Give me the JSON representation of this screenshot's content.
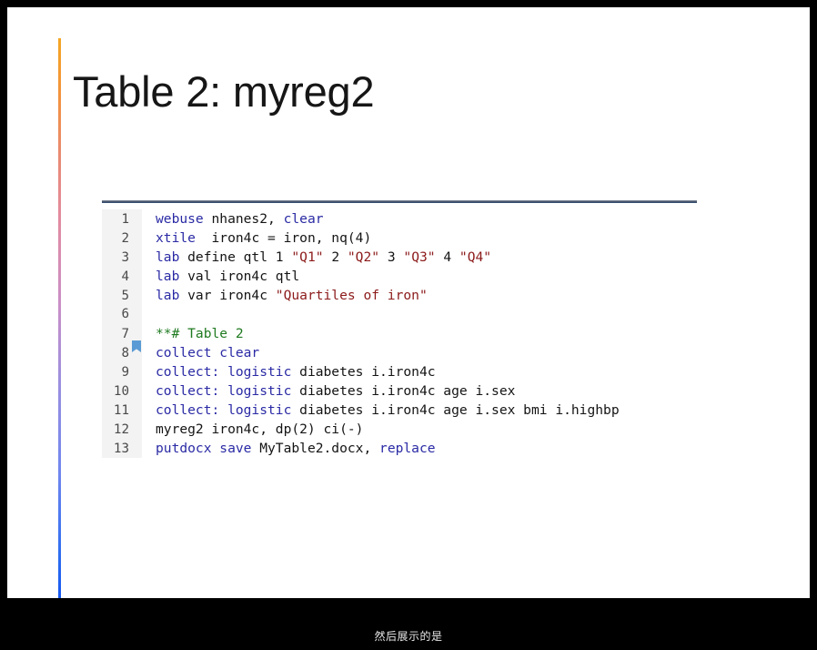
{
  "slide": {
    "title": "Table 2: myreg2",
    "accent_colors": {
      "top": "#f5a623",
      "middle": "#c98fc8",
      "bottom": "#1558f0"
    },
    "background": "#ffffff"
  },
  "caption": {
    "text": "然后展示的是"
  },
  "code_editor": {
    "syntax_colors": {
      "keyword": "#2a2aa5",
      "string": "#8c1a1a",
      "comment": "#1f7a20",
      "plain": "#141414",
      "line_number": "#4a4a4a",
      "gutter_background": "#f3f3f3",
      "bookmark_marker": "#5b9bd5"
    },
    "lines": [
      {
        "number": "1",
        "marker": "",
        "tokens": [
          {
            "text": "webuse",
            "type": "kw"
          },
          {
            "text": " nhanes2, ",
            "type": "txt"
          },
          {
            "text": "clear",
            "type": "kw"
          }
        ]
      },
      {
        "number": "2",
        "marker": "",
        "tokens": [
          {
            "text": "xtile",
            "type": "kw"
          },
          {
            "text": "  iron4c = iron, nq(4)",
            "type": "txt"
          }
        ]
      },
      {
        "number": "3",
        "marker": "",
        "tokens": [
          {
            "text": "lab",
            "type": "kw"
          },
          {
            "text": " define qtl 1 ",
            "type": "txt"
          },
          {
            "text": "\"Q1\"",
            "type": "str"
          },
          {
            "text": " 2 ",
            "type": "txt"
          },
          {
            "text": "\"Q2\"",
            "type": "str"
          },
          {
            "text": " 3 ",
            "type": "txt"
          },
          {
            "text": "\"Q3\"",
            "type": "str"
          },
          {
            "text": " 4 ",
            "type": "txt"
          },
          {
            "text": "\"Q4\"",
            "type": "str"
          }
        ]
      },
      {
        "number": "4",
        "marker": "",
        "tokens": [
          {
            "text": "lab",
            "type": "kw"
          },
          {
            "text": " val iron4c qtl",
            "type": "txt"
          }
        ]
      },
      {
        "number": "5",
        "marker": "",
        "tokens": [
          {
            "text": "lab",
            "type": "kw"
          },
          {
            "text": " var iron4c ",
            "type": "txt"
          },
          {
            "text": "\"Quartiles of iron\"",
            "type": "str"
          }
        ]
      },
      {
        "number": "6",
        "marker": "",
        "tokens": []
      },
      {
        "number": "7",
        "marker": "bookmark",
        "tokens": [
          {
            "text": "**# Table 2",
            "type": "com"
          }
        ]
      },
      {
        "number": "8",
        "marker": "",
        "tokens": [
          {
            "text": "collect clear",
            "type": "kw"
          }
        ]
      },
      {
        "number": "9",
        "marker": "",
        "tokens": [
          {
            "text": "collect: logistic",
            "type": "kw"
          },
          {
            "text": " diabetes i.iron4c",
            "type": "txt"
          }
        ]
      },
      {
        "number": "10",
        "marker": "",
        "tokens": [
          {
            "text": "collect: logistic",
            "type": "kw"
          },
          {
            "text": " diabetes i.iron4c age i.sex",
            "type": "txt"
          }
        ]
      },
      {
        "number": "11",
        "marker": "",
        "tokens": [
          {
            "text": "collect: logistic",
            "type": "kw"
          },
          {
            "text": " diabetes i.iron4c age i.sex bmi i.highbp",
            "type": "txt"
          }
        ]
      },
      {
        "number": "12",
        "marker": "",
        "tokens": [
          {
            "text": "myreg2 iron4c, dp(2) ci(-)",
            "type": "txt"
          }
        ]
      },
      {
        "number": "13",
        "marker": "",
        "tokens": [
          {
            "text": "putdocx save",
            "type": "kw"
          },
          {
            "text": " MyTable2.docx, ",
            "type": "txt"
          },
          {
            "text": "replace",
            "type": "kw"
          }
        ]
      }
    ]
  }
}
